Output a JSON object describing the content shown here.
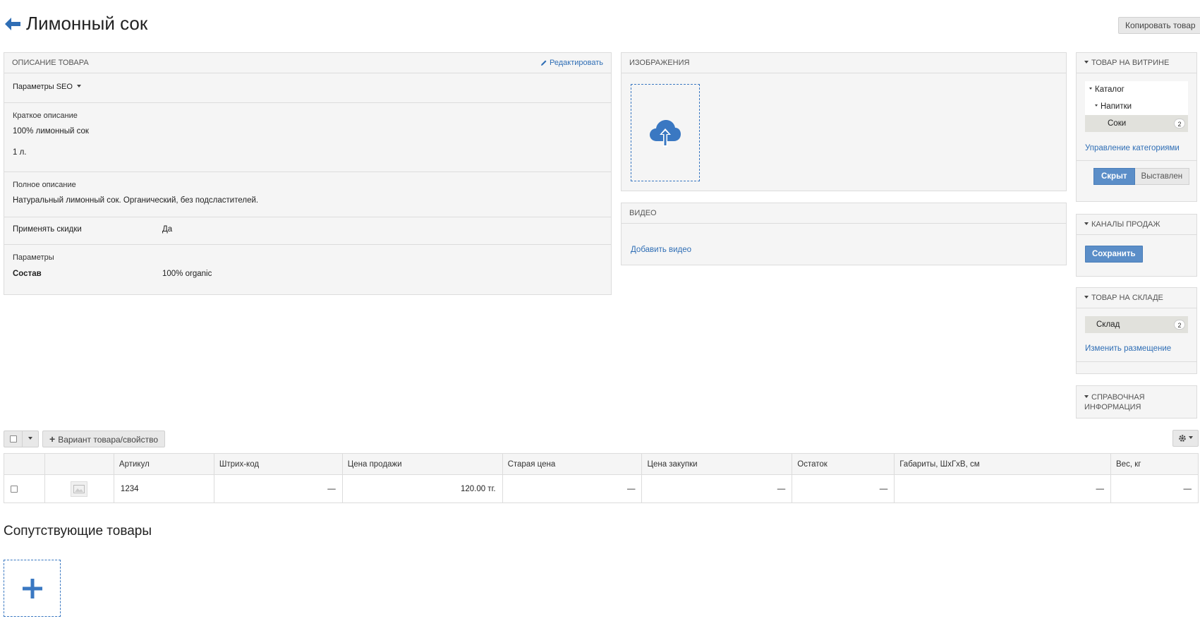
{
  "header": {
    "title": "Лимонный сок",
    "copy_button": "Копировать товар"
  },
  "description": {
    "heading": "Описание товара",
    "edit_label": "Редактировать",
    "seo_label": "Параметры SEO",
    "short_label": "Краткое описание",
    "short_text": "100% лимонный сок",
    "short_volume": "1 л.",
    "full_label": "Полное описание",
    "full_text": "Натуральный лимонный сок. Органический, без подсластителей.",
    "discount_label": "Применять скидки",
    "discount_value": "Да",
    "params_label": "Параметры",
    "params": [
      {
        "name": "Состав",
        "value": "100% organic"
      }
    ]
  },
  "images": {
    "heading": "Изображения"
  },
  "video": {
    "heading": "Видео",
    "add_label": "Добавить видео"
  },
  "showcase": {
    "heading": "Товар на витрине",
    "tree": [
      {
        "label": "Каталог",
        "level": 0
      },
      {
        "label": "Напитки",
        "level": 1
      },
      {
        "label": "Соки",
        "level": 2,
        "count": "2",
        "selected": true
      }
    ],
    "manage_link": "Управление категориями",
    "hidden_label": "Скрыт",
    "visible_label": "Выставлен"
  },
  "channels": {
    "heading": "Каналы продаж",
    "save_label": "Сохранить"
  },
  "stock": {
    "heading": "Товар на складе",
    "warehouse": "Склад",
    "count": "2",
    "change_link": "Изменить размещение"
  },
  "info": {
    "heading": "Справочная информация"
  },
  "toolbar": {
    "variant_label": "Вариант товара/свойство"
  },
  "table": {
    "columns": [
      "",
      "",
      "Артикул",
      "Штрих-код",
      "Цена продажи",
      "Старая цена",
      "Цена закупки",
      "Остаток",
      "Габариты, ШхГхВ, см",
      "Вес, кг"
    ],
    "row": {
      "sku": "1234",
      "barcode": "—",
      "price": "120.00 тг.",
      "old_price": "—",
      "purchase_price": "—",
      "stock": "—",
      "dimensions": "—",
      "weight": "—"
    }
  },
  "related": {
    "title": "Сопутствующие товары"
  },
  "colors": {
    "accent": "#2f6eb5",
    "primary_button": "#5b8ec8",
    "panel_bg": "#f5f5f5",
    "selected_bg": "#e1e1dc"
  }
}
